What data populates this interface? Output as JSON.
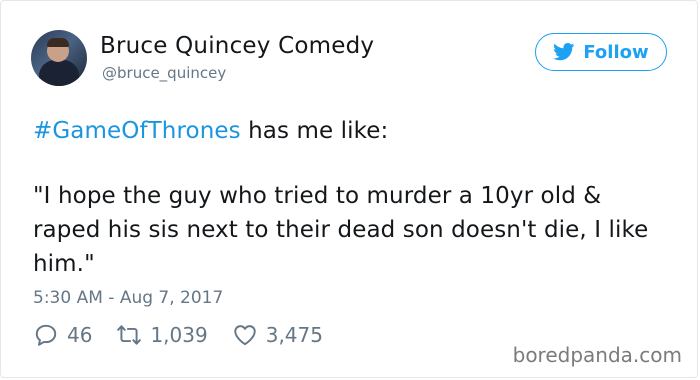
{
  "tweet": {
    "display_name": "Bruce Quincey Comedy",
    "handle": "@bruce_quincey",
    "follow_label": "Follow",
    "hashtag": "#GameOfThrones",
    "line1_rest": " has me like:",
    "quote_line1": "\"I hope the guy who tried to murder a 10yr old &",
    "quote_line2": "raped his sis next to their dead son doesn't die, I like",
    "quote_line3": "him.\"",
    "timestamp": "5:30 AM - Aug 7, 2017",
    "replies": "46",
    "retweets": "1,039",
    "likes": "3,475"
  },
  "watermark": "boredpanda.com",
  "colors": {
    "accent": "#1da1f2",
    "hashtag": "#1b95e0",
    "meta": "#657786",
    "text": "#14171a"
  },
  "icons": {
    "follow": "twitter-bird-icon",
    "reply": "reply-icon",
    "retweet": "retweet-icon",
    "like": "heart-icon"
  }
}
